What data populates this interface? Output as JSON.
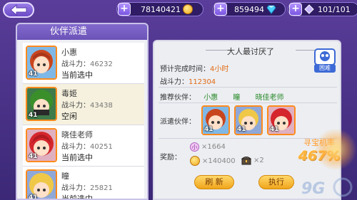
{
  "topbar": {
    "coins": "78140421",
    "gems": "859494",
    "stamina": "101/101"
  },
  "left_panel": {
    "title": "伙伴派遣",
    "partners": [
      {
        "name": "小惠",
        "power_label": "战斗力：",
        "power": "46232",
        "status": "当前选中",
        "level": "41",
        "hair": "#c8461e",
        "selected": false
      },
      {
        "name": "毒姬",
        "power_label": "战斗力：",
        "power": "43438",
        "status": "空闲",
        "level": "41",
        "hair": "#3a8f2a",
        "selected": true
      },
      {
        "name": "晓佳老师",
        "power_label": "战斗力：",
        "power": "40251",
        "status": "当前选中",
        "level": "41",
        "hair": "#d4262c",
        "selected": false
      },
      {
        "name": "瞳",
        "power_label": "战斗力：",
        "power": "25821",
        "status": "当前选中",
        "level": "41",
        "hair": "#f0c848",
        "selected": false
      }
    ]
  },
  "mission": {
    "title": "大人最讨厌了",
    "difficulty": "困难",
    "time_label": "预计完成时间：",
    "time_value": "4小时",
    "power_label": "战斗力：",
    "power_value": "112304",
    "recommend_label": "推荐伙伴：",
    "recommend": [
      "小惠",
      "瞳",
      "晓佳老师"
    ],
    "dispatch_label": "派遣伙伴：",
    "dispatch_levels": [
      "41",
      "41",
      "41"
    ],
    "reward_label": "奖励：",
    "rewards": [
      {
        "icon": "soul-icon",
        "value": "×1664"
      },
      {
        "icon": "coin-icon",
        "value": "×140400"
      },
      {
        "icon": "chest-icon",
        "value": "×2"
      }
    ],
    "refresh_button": "刷 新",
    "execute_button": "执行",
    "rate_label": "寻宝机率",
    "rate_value": "467%"
  },
  "colors": {
    "accent_purple": "#6b53b8",
    "orange_text": "#e26a14",
    "green_text": "#2a8a2a",
    "button_gold": "#f0a51c"
  }
}
